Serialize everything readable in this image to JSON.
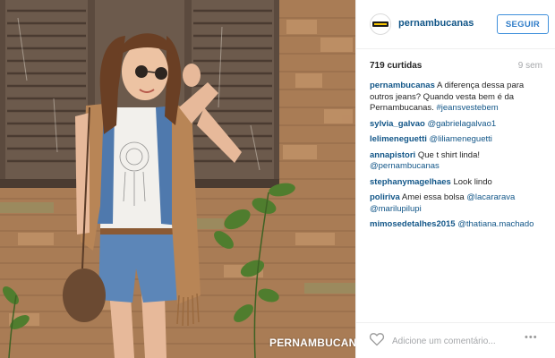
{
  "post": {
    "username": "pernambucanas",
    "follow_label": "SEGUIR",
    "likes": "719 curtidas",
    "age": "9 sem",
    "watermark": "PERNAMBUCANAS",
    "comment_placeholder": "Adicione um comentário...",
    "more_label": "•••"
  },
  "caption": {
    "user": "pernambucanas",
    "text": "A diferença dessa para outros jeans? Quando vesta bem é da Pernambucanas.",
    "hashtag": "#jeansvestebem"
  },
  "comments": [
    {
      "user": "sylvia_galvao",
      "text": "",
      "mention": "@gabrielagalvao1"
    },
    {
      "user": "lelimeneguetti",
      "text": "",
      "mention": "@liliameneguetti"
    },
    {
      "user": "annapistori",
      "text": "Que t shirt linda!",
      "mention": "@pernambucanas"
    },
    {
      "user": "stephanymagelhaes",
      "text": "Look lindo",
      "mention": ""
    },
    {
      "user": "poliriva",
      "text": "Amei essa bolsa",
      "mention": "@lacararava @marilupilupi"
    },
    {
      "user": "mimosedetalhes2015",
      "text": "",
      "mention": "@thatiana.machado"
    }
  ],
  "colors": {
    "username_blue": "#125688",
    "follow_blue": "#4090db",
    "muted_gray": "#a5a7aa",
    "brick": "#b8845a",
    "shutter": "#5b4a3e"
  },
  "icons": [
    "heart-icon",
    "more-options-icon",
    "brand-logo-icon"
  ]
}
